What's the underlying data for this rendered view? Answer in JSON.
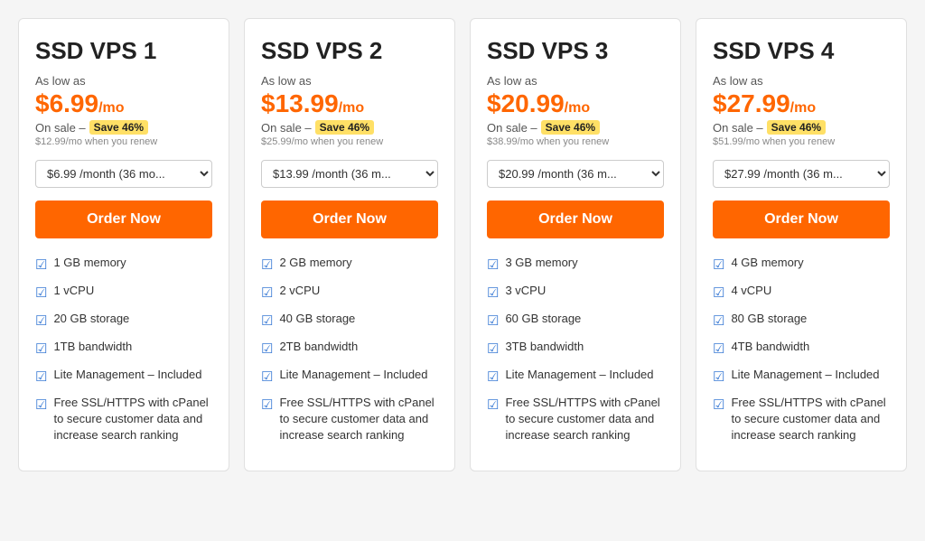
{
  "plans": [
    {
      "id": "vps1",
      "title": "SSD VPS 1",
      "as_low_as": "As low as",
      "price": "$6.99",
      "per_mo": "/mo",
      "sale_text": "On sale –",
      "save_text": "Save 46%",
      "renew_text": "$12.99/mo when you renew",
      "select_value": "$6.99 /month (36 mo...",
      "order_label": "Order Now",
      "features": [
        "1 GB memory",
        "1 vCPU",
        "20 GB storage",
        "1TB bandwidth",
        "Lite Management – Included",
        "Free SSL/HTTPS with cPanel to secure customer data and increase search ranking"
      ]
    },
    {
      "id": "vps2",
      "title": "SSD VPS 2",
      "as_low_as": "As low as",
      "price": "$13.99",
      "per_mo": "/mo",
      "sale_text": "On sale –",
      "save_text": "Save 46%",
      "renew_text": "$25.99/mo when you renew",
      "select_value": "$13.99 /month (36 m...",
      "order_label": "Order Now",
      "features": [
        "2 GB memory",
        "2 vCPU",
        "40 GB storage",
        "2TB bandwidth",
        "Lite Management – Included",
        "Free SSL/HTTPS with cPanel to secure customer data and increase search ranking"
      ]
    },
    {
      "id": "vps3",
      "title": "SSD VPS 3",
      "as_low_as": "As low as",
      "price": "$20.99",
      "per_mo": "/mo",
      "sale_text": "On sale –",
      "save_text": "Save 46%",
      "renew_text": "$38.99/mo when you renew",
      "select_value": "$20.99 /month (36 m...",
      "order_label": "Order Now",
      "features": [
        "3 GB memory",
        "3 vCPU",
        "60 GB storage",
        "3TB bandwidth",
        "Lite Management – Included",
        "Free SSL/HTTPS with cPanel to secure customer data and increase search ranking"
      ]
    },
    {
      "id": "vps4",
      "title": "SSD VPS 4",
      "as_low_as": "As low as",
      "price": "$27.99",
      "per_mo": "/mo",
      "sale_text": "On sale –",
      "save_text": "Save 46%",
      "renew_text": "$51.99/mo when you renew",
      "select_value": "$27.99 /month (36 m...",
      "order_label": "Order Now",
      "features": [
        "4 GB memory",
        "4 vCPU",
        "80 GB storage",
        "4TB bandwidth",
        "Lite Management – Included",
        "Free SSL/HTTPS with cPanel to secure customer data and increase search ranking"
      ]
    }
  ]
}
